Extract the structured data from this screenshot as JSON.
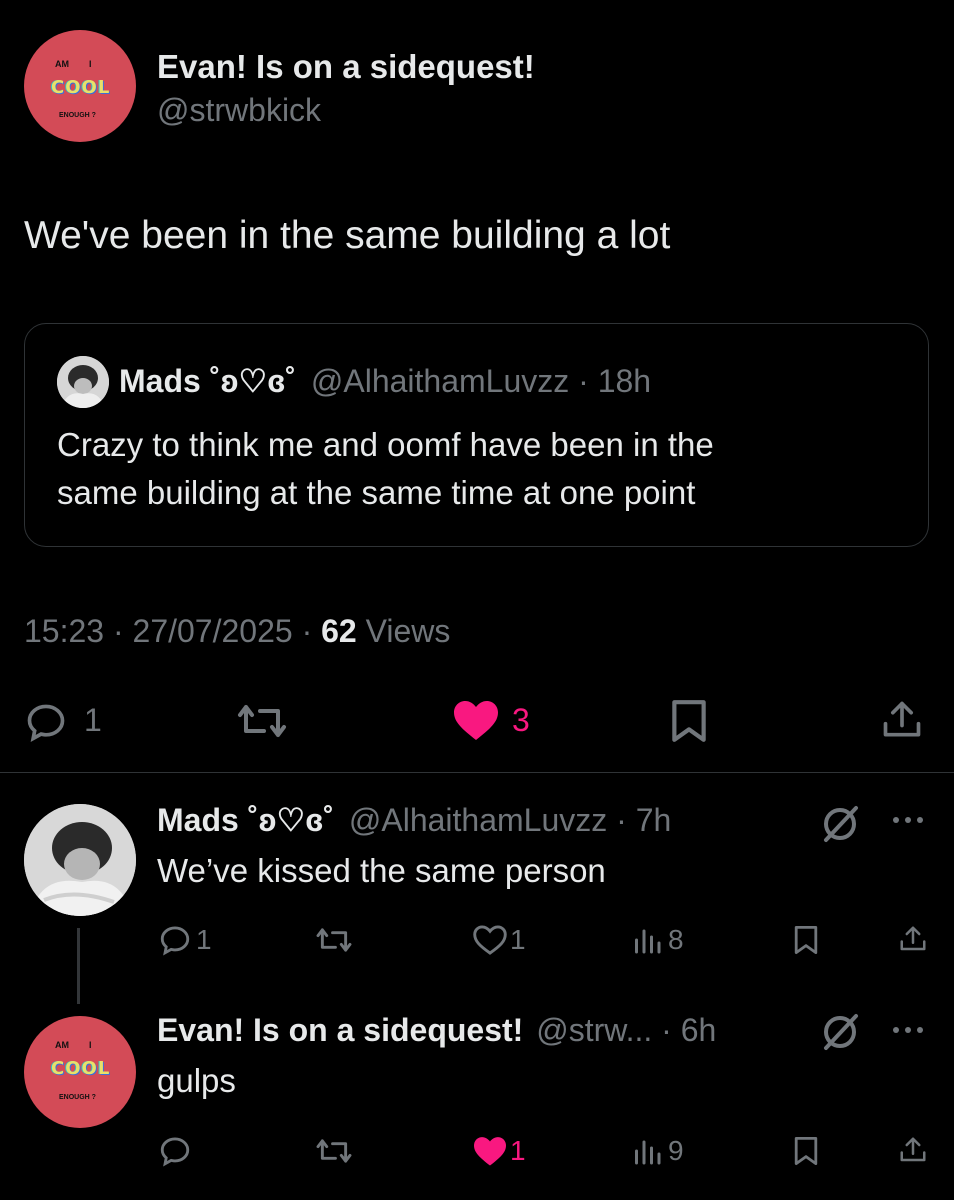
{
  "main_tweet": {
    "author_name": "Evan! Is on a sidequest!",
    "author_handle": "@strwbkick",
    "avatar_text": {
      "top_left": "AM",
      "top_right": "I",
      "middle": "COOL",
      "bottom": "ENOUGH ?"
    },
    "text": "We've been in the same building a lot",
    "quote": {
      "author_name": "Mads ˚ʚ♡ɞ˚",
      "author_handle": "@AlhaithamLuvzz",
      "time": "18h",
      "text_line1": "Crazy to think me and oomf have been in the",
      "text_line2": "same building at the same time at one point"
    },
    "time": "15:23",
    "date": "27/07/2025",
    "views_count": "62",
    "views_label": "Views",
    "actions": {
      "reply_count": "1",
      "retweet_count": "",
      "like_count": "3"
    }
  },
  "replies": [
    {
      "author_name": "Mads ˚ʚ♡ɞ˚",
      "author_handle": "@AlhaithamLuvzz",
      "time": "7h",
      "text": "We’ve kissed the same person",
      "reply_count": "1",
      "like_count": "1",
      "views_count": "8"
    },
    {
      "author_name": "Evan! Is on a sidequest!",
      "author_handle": "@strw...",
      "time": "6h",
      "text": "gulps",
      "like_count": "1",
      "views_count": "9"
    }
  ],
  "separator": "·",
  "colors": {
    "background": "#000000",
    "text": "#e7e9ea",
    "muted": "#71767b",
    "like_pink": "#f91880",
    "border": "#2f3336",
    "avatar_red": "#d34b57"
  }
}
